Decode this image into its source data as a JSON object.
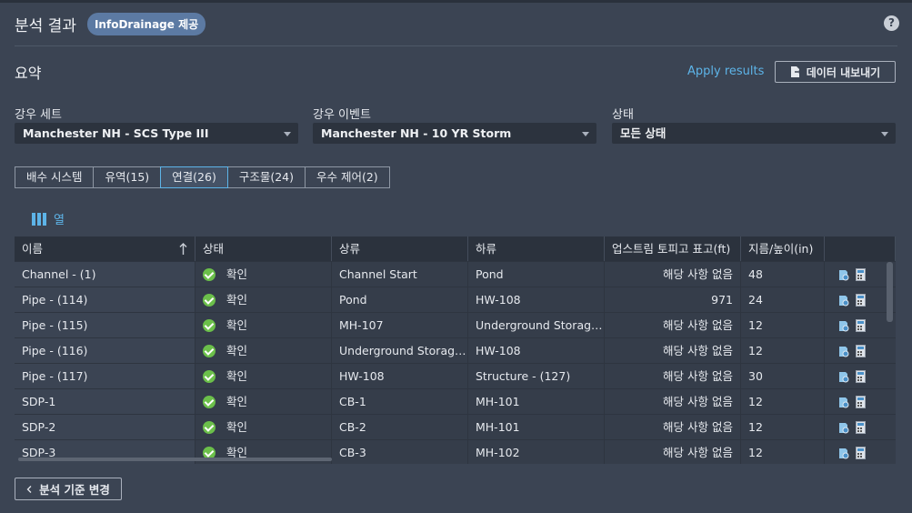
{
  "header": {
    "title": "분석 결과",
    "badge": "InfoDrainage 제공"
  },
  "summary": {
    "title": "요약",
    "apply_label": "Apply results",
    "export_label": "데이터 내보내기"
  },
  "filters": {
    "rainfall_set": {
      "label": "강우 세트",
      "value": "Manchester NH - SCS Type III"
    },
    "rainfall_event": {
      "label": "강우 이벤트",
      "value": "Manchester NH - 10 YR Storm"
    },
    "status": {
      "label": "상태",
      "value": "모든 상태"
    }
  },
  "tabs": [
    "배수 시스템",
    "유역(15)",
    "연결(26)",
    "구조물(24)",
    "우수 제어(2)"
  ],
  "active_tab": "연결(26)",
  "columns_label": "열",
  "table": {
    "headers": [
      "이름",
      "상태",
      "상류",
      "하류",
      "업스트림 토피고 표고(ft)",
      "지름/높이(in)"
    ],
    "rows": [
      [
        "Channel - (1)",
        "확인",
        "Channel Start",
        "Pond",
        "해당 사항 없음",
        "48"
      ],
      [
        "Pipe - (114)",
        "확인",
        "Pond",
        "HW-108",
        "971",
        "24"
      ],
      [
        "Pipe - (115)",
        "확인",
        "MH-107",
        "Underground Storage ...",
        "해당 사항 없음",
        "12"
      ],
      [
        "Pipe - (116)",
        "확인",
        "Underground Storage ...",
        "HW-108",
        "해당 사항 없음",
        "12"
      ],
      [
        "Pipe - (117)",
        "확인",
        "HW-108",
        "Structure - (127)",
        "해당 사항 없음",
        "30"
      ],
      [
        "SDP-1",
        "확인",
        "CB-1",
        "MH-101",
        "해당 사항 없음",
        "12"
      ],
      [
        "SDP-2",
        "확인",
        "CB-2",
        "MH-101",
        "해당 사항 없음",
        "12"
      ],
      [
        "SDP-3",
        "확인",
        "CB-3",
        "MH-102",
        "해당 사항 없음",
        "12"
      ]
    ]
  },
  "footer": {
    "back_label": "분석 기준 변경"
  },
  "colors": {
    "accent": "#5db4e8",
    "ok": "#6bbf4a",
    "background": "#3b4453"
  },
  "icons": [
    "help-icon",
    "export-icon",
    "columns-icon",
    "sort-ascending-icon",
    "status-ok-icon",
    "view-profile-icon",
    "calculator-icon",
    "chevron-left-icon"
  ]
}
